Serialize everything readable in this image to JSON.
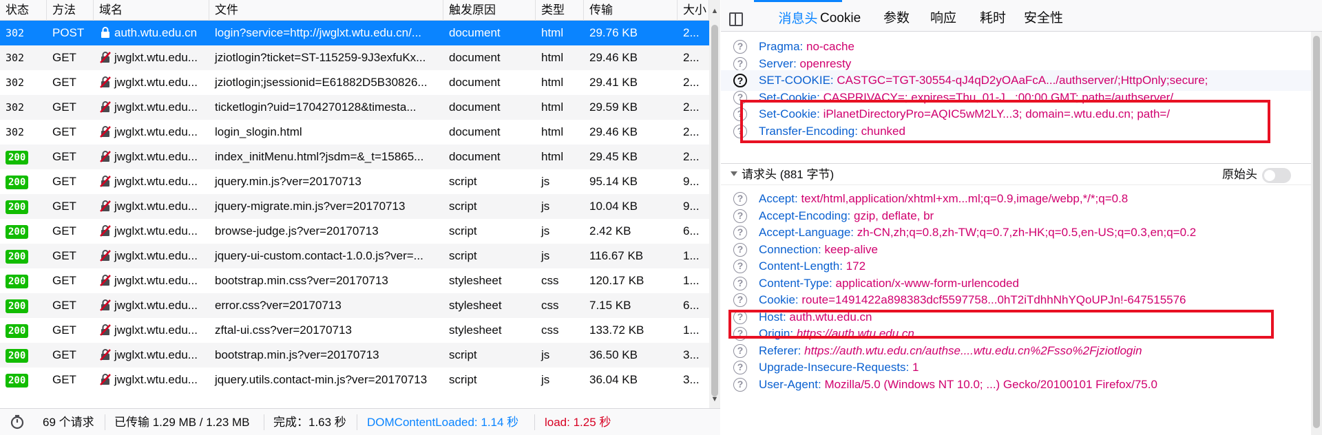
{
  "columns": [
    "状态",
    "方法",
    "域名",
    "文件",
    "触发原因",
    "类型",
    "传输",
    "大小"
  ],
  "rows": [
    {
      "status": "302",
      "method": "POST",
      "secure": true,
      "domain": "auth.wtu.edu.cn",
      "file": "login?service=http://jwglxt.wtu.edu.cn/...",
      "cause": "document",
      "type": "html",
      "transferred": "29.76 KB",
      "size": "2..."
    },
    {
      "status": "302",
      "method": "GET",
      "secure": false,
      "domain": "jwglxt.wtu.edu...",
      "file": "jziotlogin?ticket=ST-115259-9J3exfuKx...",
      "cause": "document",
      "type": "html",
      "transferred": "29.46 KB",
      "size": "2..."
    },
    {
      "status": "302",
      "method": "GET",
      "secure": false,
      "domain": "jwglxt.wtu.edu...",
      "file": "jziotlogin;jsessionid=E61882D5B30826...",
      "cause": "document",
      "type": "html",
      "transferred": "29.41 KB",
      "size": "2..."
    },
    {
      "status": "302",
      "method": "GET",
      "secure": false,
      "domain": "jwglxt.wtu.edu...",
      "file": "ticketlogin?uid=1704270128&timesta...",
      "cause": "document",
      "type": "html",
      "transferred": "29.59 KB",
      "size": "2..."
    },
    {
      "status": "302",
      "method": "GET",
      "secure": false,
      "domain": "jwglxt.wtu.edu...",
      "file": "login_slogin.html",
      "cause": "document",
      "type": "html",
      "transferred": "29.46 KB",
      "size": "2..."
    },
    {
      "status": "200",
      "method": "GET",
      "secure": false,
      "domain": "jwglxt.wtu.edu...",
      "file": "index_initMenu.html?jsdm=&_t=15865...",
      "cause": "document",
      "type": "html",
      "transferred": "29.45 KB",
      "size": "2..."
    },
    {
      "status": "200",
      "method": "GET",
      "secure": false,
      "domain": "jwglxt.wtu.edu...",
      "file": "jquery.min.js?ver=20170713",
      "cause": "script",
      "type": "js",
      "transferred": "95.14 KB",
      "size": "9..."
    },
    {
      "status": "200",
      "method": "GET",
      "secure": false,
      "domain": "jwglxt.wtu.edu...",
      "file": "jquery-migrate.min.js?ver=20170713",
      "cause": "script",
      "type": "js",
      "transferred": "10.04 KB",
      "size": "9..."
    },
    {
      "status": "200",
      "method": "GET",
      "secure": false,
      "domain": "jwglxt.wtu.edu...",
      "file": "browse-judge.js?ver=20170713",
      "cause": "script",
      "type": "js",
      "transferred": "2.42 KB",
      "size": "6..."
    },
    {
      "status": "200",
      "method": "GET",
      "secure": false,
      "domain": "jwglxt.wtu.edu...",
      "file": "jquery-ui-custom.contact-1.0.0.js?ver=...",
      "cause": "script",
      "type": "js",
      "transferred": "116.67 KB",
      "size": "1..."
    },
    {
      "status": "200",
      "method": "GET",
      "secure": false,
      "domain": "jwglxt.wtu.edu...",
      "file": "bootstrap.min.css?ver=20170713",
      "cause": "stylesheet",
      "type": "css",
      "transferred": "120.17 KB",
      "size": "1..."
    },
    {
      "status": "200",
      "method": "GET",
      "secure": false,
      "domain": "jwglxt.wtu.edu...",
      "file": "error.css?ver=20170713",
      "cause": "stylesheet",
      "type": "css",
      "transferred": "7.15 KB",
      "size": "6..."
    },
    {
      "status": "200",
      "method": "GET",
      "secure": false,
      "domain": "jwglxt.wtu.edu...",
      "file": "zftal-ui.css?ver=20170713",
      "cause": "stylesheet",
      "type": "css",
      "transferred": "133.72 KB",
      "size": "1..."
    },
    {
      "status": "200",
      "method": "GET",
      "secure": false,
      "domain": "jwglxt.wtu.edu...",
      "file": "bootstrap.min.js?ver=20170713",
      "cause": "script",
      "type": "js",
      "transferred": "36.50 KB",
      "size": "3..."
    },
    {
      "status": "200",
      "method": "GET",
      "secure": false,
      "domain": "jwglxt.wtu.edu...",
      "file": "jquery.utils.contact-min.js?ver=20170713",
      "cause": "script",
      "type": "js",
      "transferred": "36.04 KB",
      "size": "3..."
    }
  ],
  "status_bar": {
    "requests": "69 个请求",
    "transferred": "已传输 1.29 MB / 1.23 MB",
    "finish": "完成：1.63 秒",
    "dom": "DOMContentLoaded: 1.14 秒",
    "load": "load: 1.25 秒"
  },
  "tabs": [
    "消息头",
    "Cookie",
    "参数",
    "响应",
    "耗时",
    "安全性"
  ],
  "response_headers": [
    {
      "name": "Pragma:",
      "value": "no-cache"
    },
    {
      "name": "Server:",
      "value": "openresty"
    },
    {
      "name": "SET-COOKIE:",
      "value": "CASTGC=TGT-30554-qJ4qD2yOAaFcA.../authserver/;HttpOnly;secure;",
      "strong": true
    },
    {
      "name": "Set-Cookie:",
      "value": "CASPRIVACY=; expires=Thu, 01-J...:00:00 GMT; path=/authserver/"
    },
    {
      "name": "Set-Cookie:",
      "value": "iPlanetDirectoryPro=AQIC5wM2LY...3; domain=.wtu.edu.cn; path=/"
    },
    {
      "name": "Transfer-Encoding:",
      "value": "chunked"
    }
  ],
  "request_section": {
    "title": "请求头 (881 字节)",
    "raw_label": "原始头"
  },
  "request_headers": [
    {
      "name": "Accept:",
      "value": "text/html,application/xhtml+xm...ml;q=0.9,image/webp,*/*;q=0.8"
    },
    {
      "name": "Accept-Encoding:",
      "value": "gzip, deflate, br"
    },
    {
      "name": "Accept-Language:",
      "value": "zh-CN,zh;q=0.8,zh-TW;q=0.7,zh-HK;q=0.5,en-US;q=0.3,en;q=0.2"
    },
    {
      "name": "Connection:",
      "value": "keep-alive"
    },
    {
      "name": "Content-Length:",
      "value": "172"
    },
    {
      "name": "Content-Type:",
      "value": "application/x-www-form-urlencoded"
    },
    {
      "name": "Cookie:",
      "value": "route=1491422a898383dcf5597758...0hT2iTdhhNhYQoUPJn!-647515576"
    },
    {
      "name": "Host:",
      "value": "auth.wtu.edu.cn"
    },
    {
      "name": "Origin:",
      "value": "https://auth.wtu.edu.cn",
      "italic": true
    },
    {
      "name": "Referer:",
      "value": "https://auth.wtu.edu.cn/authse....wtu.edu.cn%2Fsso%2Fjziotlogin",
      "italic": true
    },
    {
      "name": "Upgrade-Insecure-Requests:",
      "value": "1"
    },
    {
      "name": "User-Agent:",
      "value": "Mozilla/5.0 (Windows NT 10.0; ...) Gecko/20100101 Firefox/75.0"
    }
  ]
}
